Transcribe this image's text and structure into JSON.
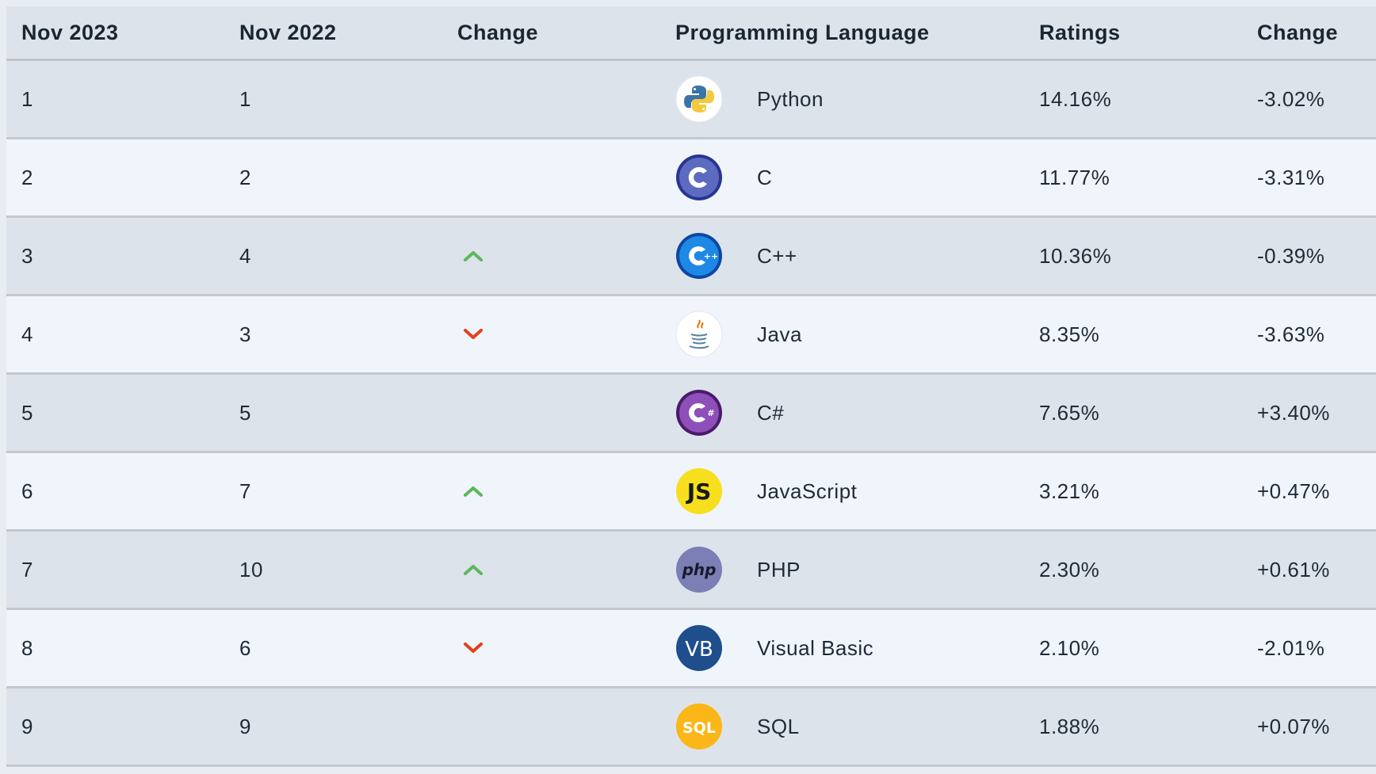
{
  "header": {
    "col1": "Nov 2023",
    "col2": "Nov 2022",
    "col3": "Change",
    "col4": "Programming Language",
    "col5": "Ratings",
    "col6": "Change"
  },
  "colors": {
    "up": "#5cb85c",
    "down": "#e2401f"
  },
  "rows": [
    {
      "rank_2023": "1",
      "rank_2022": "1",
      "trend": "none",
      "language": "Python",
      "icon": "python-logo-icon",
      "rating": "14.16%",
      "change": "-3.02%"
    },
    {
      "rank_2023": "2",
      "rank_2022": "2",
      "trend": "none",
      "language": "C",
      "icon": "c-logo-icon",
      "rating": "11.77%",
      "change": "-3.31%"
    },
    {
      "rank_2023": "3",
      "rank_2022": "4",
      "trend": "up",
      "language": "C++",
      "icon": "cpp-logo-icon",
      "rating": "10.36%",
      "change": "-0.39%"
    },
    {
      "rank_2023": "4",
      "rank_2022": "3",
      "trend": "down",
      "language": "Java",
      "icon": "java-logo-icon",
      "rating": "8.35%",
      "change": "-3.63%"
    },
    {
      "rank_2023": "5",
      "rank_2022": "5",
      "trend": "none",
      "language": "C#",
      "icon": "csharp-logo-icon",
      "rating": "7.65%",
      "change": "+3.40%"
    },
    {
      "rank_2023": "6",
      "rank_2022": "7",
      "trend": "up",
      "language": "JavaScript",
      "icon": "javascript-logo-icon",
      "rating": "3.21%",
      "change": "+0.47%"
    },
    {
      "rank_2023": "7",
      "rank_2022": "10",
      "trend": "up",
      "language": "PHP",
      "icon": "php-logo-icon",
      "rating": "2.30%",
      "change": "+0.61%"
    },
    {
      "rank_2023": "8",
      "rank_2022": "6",
      "trend": "down",
      "language": "Visual Basic",
      "icon": "visual-basic-logo-icon",
      "rating": "2.10%",
      "change": "-2.01%"
    },
    {
      "rank_2023": "9",
      "rank_2022": "9",
      "trend": "none",
      "language": "SQL",
      "icon": "sql-logo-icon",
      "rating": "1.88%",
      "change": "+0.07%"
    }
  ]
}
